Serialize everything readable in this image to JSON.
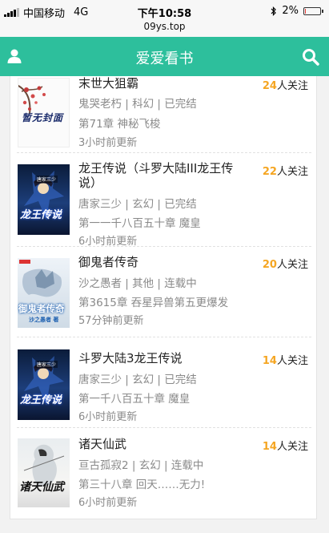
{
  "status_bar": {
    "carrier": "中国移动",
    "network": "4G",
    "time": "下午10:58",
    "bluetooth_icon": "bluetooth-icon",
    "battery_percent": "2%",
    "battery_level": 0.02
  },
  "url_bar": {
    "url": "09ys.top"
  },
  "header": {
    "title": "爱爱看书",
    "user_icon": "user-icon",
    "search_icon": "search-icon"
  },
  "books": [
    {
      "title": "末世大狙霸",
      "follow_count": "24",
      "follow_suffix": "人关注",
      "meta": "鬼哭老朽 | 科幻 | 已完结",
      "chapter": "第71章 神秘飞梭",
      "updated": "3小时前更新",
      "cover_label": "暂无封面"
    },
    {
      "title": "龙王传说（斗罗大陆III龙王传说）",
      "follow_count": "22",
      "follow_suffix": "人关注",
      "meta": "唐家三少 | 玄幻 | 已完结",
      "chapter": "第一一千八百五十章 魔皇",
      "updated": "6小时前更新",
      "cover_label": "龙王传说",
      "cover_author": "唐家三少"
    },
    {
      "title": "御鬼者传奇",
      "follow_count": "20",
      "follow_suffix": "人关注",
      "meta": "沙之愚者 | 其他 | 连载中",
      "chapter": "第3615章 吞星异兽第五更爆发",
      "updated": "57分钟前更新",
      "cover_label": "御鬼者传奇",
      "cover_sub": "沙之愚者 著"
    },
    {
      "title": "斗罗大陆3龙王传说",
      "follow_count": "14",
      "follow_suffix": "人关注",
      "meta": "唐家三少 | 玄幻 | 已完结",
      "chapter": "第一千八百五十章 魔皇",
      "updated": "6小时前更新",
      "cover_label": "龙王传说",
      "cover_author": "唐家三少"
    },
    {
      "title": "诸天仙武",
      "follow_count": "14",
      "follow_suffix": "人关注",
      "meta": "亘古孤寂2 | 玄幻 | 连载中",
      "chapter": "第三十八章 回天……无力!",
      "updated": "6小时前更新",
      "cover_label": "诸天仙武"
    }
  ],
  "colors": {
    "header_bg": "#2dbf9c",
    "follow_number": "#f5a623",
    "meta_text": "#8a8a8a"
  }
}
